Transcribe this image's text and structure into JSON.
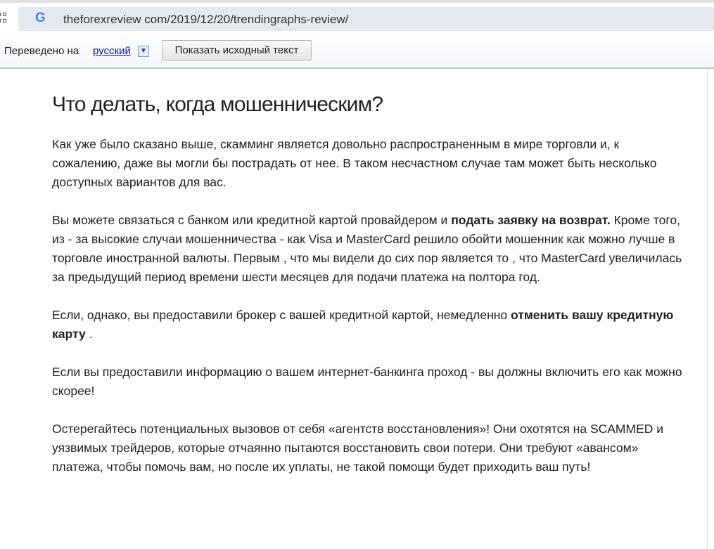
{
  "browser": {
    "url": "theforexreview com/2019/12/20/trendingraphs-review/",
    "google_logo": "G"
  },
  "translate_bar": {
    "label": "Переведено на",
    "language": "русский",
    "dropdown_glyph": "▼",
    "show_original": "Показать исходный текст"
  },
  "article": {
    "heading": "Что делать, когда мошенническим?",
    "p1": "Как уже было сказано выше, скамминг является довольно распространенным в мире торговли и, к сожалению, даже вы могли бы пострадать от нее. В таком несчастном случае там может быть несколько доступных вариантов для вас.",
    "p2a": "Вы можете связаться с банком или кредитной картой провайдером и ",
    "p2b": "подать заявку на возврат.",
    "p2c": " Кроме того, из - за высокие случаи мошенничества - как Visa и MasterCard решило обойти мошенник как можно лучше в торговле иностранной валюты. Первым , что мы видели до сих пор является то , что MasterCard увеличилась за предыдущий период времени шести месяцев для подачи платежа на полтора год.",
    "p3a": "Если, однако, вы предоставили брокер с вашей кредитной картой, немедленно ",
    "p3b": "отменить вашу кредитную карту",
    "p3c": " .",
    "p4": "Если вы предоставили информацию о вашем интернет-банкинга проход - вы должны включить его как можно скорее!",
    "p5": "Остерегайтесь потенциальных вызовов от себя «агентств восстановления»! Они охотятся на SCAMMED и уязвимых трейдеров, которые отчаянно пытаются восстановить свои потери. Они требуют «авансом» платежа, чтобы помочь вам, но после их уплаты, не такой помощи будет приходить ваш путь!"
  }
}
